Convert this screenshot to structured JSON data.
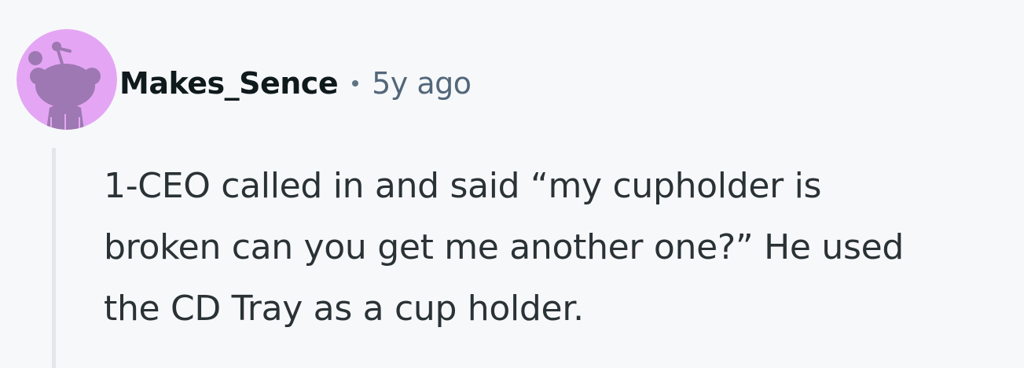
{
  "comment": {
    "author": "Makes_Sence",
    "separator": "•",
    "timestamp": "5y ago",
    "body_lines": [
      "1-CEO called in and said “my cupholder is",
      "broken can you get me another one?” He used",
      "the CD Tray as a cup holder."
    ],
    "avatar": {
      "icon": "snoo-avatar-icon",
      "background_color": "#e4a6f4",
      "figure_color": "#9e78b2"
    }
  }
}
